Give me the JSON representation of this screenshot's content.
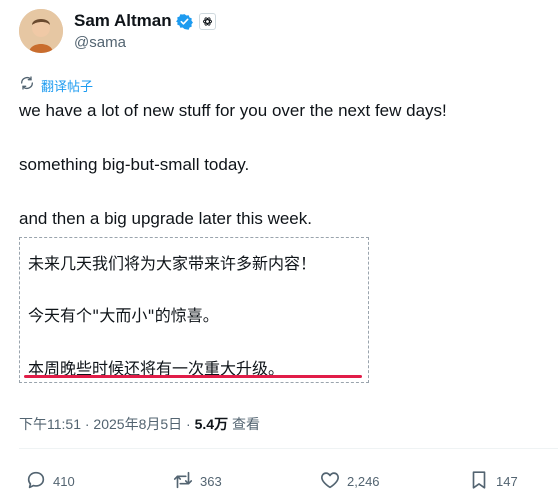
{
  "user": {
    "display_name": "Sam Altman",
    "handle": "@sama"
  },
  "translate": {
    "label": "翻译帖子"
  },
  "tweet": {
    "line1": "we have a lot of new stuff for you over the next few days!",
    "line2": "something big-but-small today.",
    "line3": "and then a big upgrade later this week."
  },
  "translation": {
    "line1": "未来几天我们将为大家带来许多新内容！",
    "line2": "今天有个\"大而小\"的惊喜。",
    "line3": "本周晚些时候还将有一次重大升级。"
  },
  "meta": {
    "timestamp": "下午11:51 · 2025年8月5日 · ",
    "views": "5.4万",
    "views_label": " 查看"
  },
  "actions": {
    "replies": "410",
    "reposts": "363",
    "likes": "2,246",
    "bookmarks": "147"
  },
  "colors": {
    "accent": "#1d9bf0",
    "underline": "#e11d48",
    "muted": "#536471"
  },
  "icons": [
    "verified-badge-icon",
    "openai-affiliate-icon",
    "translate-icon",
    "reply-icon",
    "repost-icon",
    "like-icon",
    "bookmark-icon"
  ]
}
